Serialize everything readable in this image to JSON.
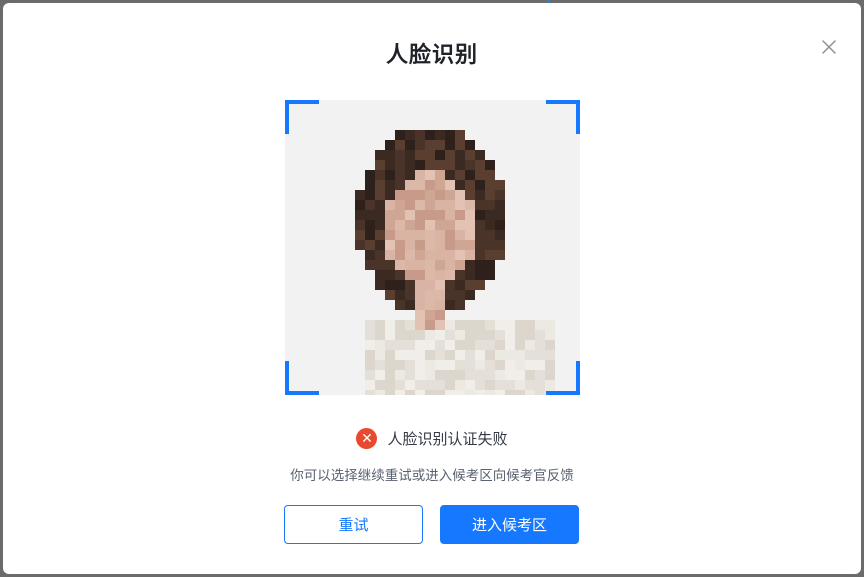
{
  "dialog": {
    "title": "人脸识别",
    "close_icon": "close-icon"
  },
  "photo": {
    "alt": "pixelated face photo",
    "frame_color": "#1677ff"
  },
  "status": {
    "icon": "error-icon",
    "icon_glyph": "✕",
    "text": "人脸识别认证失败",
    "color": "#e84a2f"
  },
  "hint": "你可以选择继续重试或进入候考区向候考官反馈",
  "buttons": {
    "retry_label": "重试",
    "enter_label": "进入候考区"
  }
}
